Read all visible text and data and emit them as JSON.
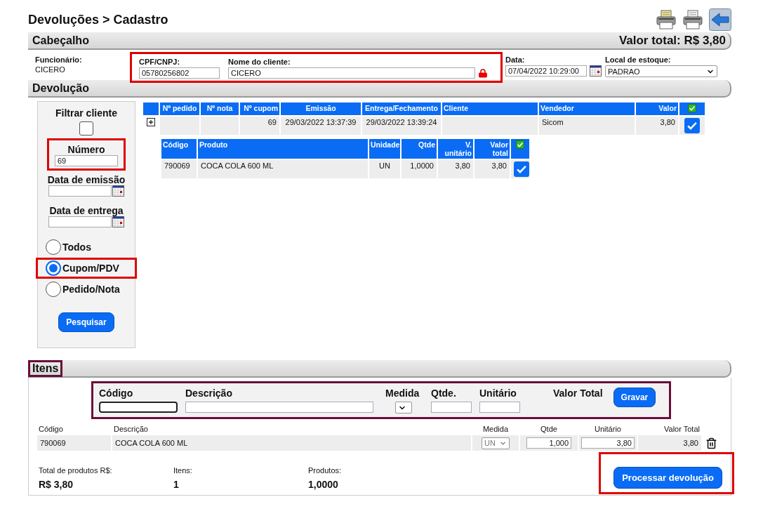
{
  "page": {
    "title": "Devoluções > Cadastro"
  },
  "header": {
    "title": "Cabeçalho",
    "total": "Valor total: R$ 3,80",
    "fields": [
      {
        "kind": "text",
        "label": "Funcionário:",
        "value": "CICERO"
      },
      {
        "kind": "group",
        "highlighted": true,
        "fields": [
          {
            "kind": "input",
            "label": "CPF/CNPJ:",
            "value": "05780256802"
          },
          {
            "kind": "client",
            "label": "Nome do cliente:",
            "value": "CICERO"
          }
        ]
      },
      {
        "kind": "date",
        "label": "Data:",
        "value": "07/04/2022 10:29:00"
      },
      {
        "kind": "select",
        "label": "Local de estoque:",
        "value": "PADRAO"
      }
    ]
  },
  "devolucao": {
    "title": "Devolução",
    "filter": {
      "client_label": "Filtrar cliente",
      "client_checked": false,
      "numero": {
        "label": "Número",
        "value": "69",
        "highlighted": true
      },
      "dates": [
        {
          "label": "Data de emissão"
        },
        {
          "label": "Data de entrega"
        }
      ],
      "radios": [
        {
          "label": "Todos",
          "selected": false,
          "highlighted": false
        },
        {
          "label": "Cupom/PDV",
          "selected": true,
          "highlighted": true
        },
        {
          "label": "Pedido/Nota",
          "selected": false,
          "highlighted": false
        }
      ],
      "button": "Pesquisar"
    },
    "orders": {
      "columns": [
        "Nº pedido",
        "Nº nota",
        "Nº cupom",
        "Emissão",
        "Entrega/Fechamento",
        "Cliente",
        "Vendedor",
        "Valor"
      ],
      "all_checked": true,
      "rows": [
        {
          "expanded": true,
          "checked": true,
          "cells": [
            "",
            "",
            "69",
            "29/03/2022 13:37:39",
            "29/03/2022 13:39:24",
            "",
            "Sicom",
            "3,80"
          ]
        }
      ]
    },
    "products": {
      "columns": [
        "Código",
        "Produto",
        "Unidade",
        "Qtde",
        "V. unitário",
        "Valor total"
      ],
      "all_checked": true,
      "rows": [
        {
          "checked": true,
          "cells": [
            "790069",
            "COCA COLA 600 ML",
            "UN",
            "1,0000",
            "3,80",
            "3,80"
          ]
        }
      ]
    }
  },
  "itens": {
    "title": "Itens",
    "highlighted": true,
    "form": {
      "highlighted": true,
      "codigo": "Código",
      "descricao": "Descrição",
      "medida": "Medida",
      "qtde": "Qtde.",
      "unitario": "Unitário",
      "valor_total": "Valor Total",
      "button": "Gravar"
    },
    "columns": [
      "Código",
      "Descrição",
      "Medida",
      "Qtde",
      "Unitário",
      "Valor Total"
    ],
    "rows": [
      {
        "codigo": "790069",
        "descricao": "COCA COLA 600 ML",
        "medida": "UN",
        "qtde": "1,000",
        "unitario": "3,80",
        "valor_total": "3,80"
      }
    ],
    "totals": [
      {
        "label": "Total de produtos R$:",
        "value": "R$ 3,80"
      },
      {
        "label": "Itens:",
        "value": "1"
      },
      {
        "label": "Produtos:",
        "value": "1,0000"
      }
    ],
    "button": {
      "label": "Processar devolução",
      "highlighted": true
    }
  }
}
